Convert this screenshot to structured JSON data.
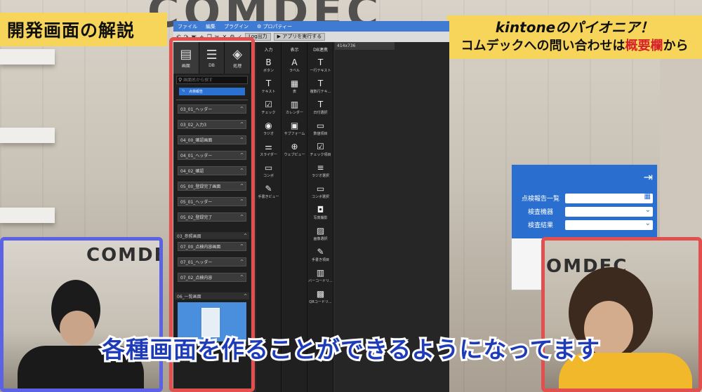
{
  "overlay": {
    "title_left": "開発画面の解説",
    "title_right_line1": "kintoneのパイオニア！",
    "title_right_line2_pre": "コムデックへの問い合わせは",
    "title_right_line2_hl": "概要欄",
    "title_right_line2_post": "から",
    "subtitle_blue1": "各種画面を作ることができる",
    "subtitle_blue2": "ようになってます",
    "bg_logo": "COMDEC",
    "cam_logo_left": "COMDE",
    "cam_logo_right": "OMDEC"
  },
  "app": {
    "menu": [
      "ファイル",
      "編集",
      "プラグイン",
      "⚙ プロパティー"
    ],
    "toolbar": {
      "log_button": "Log出力",
      "run_button": "▶ アプリを実行する"
    },
    "left_tabs": [
      {
        "label": "画面",
        "icon": "screen-icon"
      },
      {
        "label": "DB",
        "icon": "database-icon"
      },
      {
        "label": "処理",
        "icon": "process-icon"
      }
    ],
    "search_placeholder": "画面名から探す",
    "preview_button": "点検報告",
    "screens_group1": [
      "03_01_ヘッダー",
      "03_02_入力3",
      "04_00_確認画面",
      "04_01_ヘッダー",
      "04_02_確認",
      "05_00_登録完了画面",
      "05_01_ヘッダー",
      "05_02_登録完了"
    ],
    "group2_header": "03_参照画面",
    "screens_group2": [
      "07_00_点検内容画面",
      "07_01_ヘッダー",
      "07_02_点検内容"
    ],
    "group3_header": "06_一覧画面",
    "palette": {
      "input_header": "入力",
      "display_header": "表示",
      "db_header": "DB連携",
      "input_items": [
        "ボタン",
        "テキスト",
        "チェック",
        "ラジオ",
        "スライダー",
        "コンボ",
        "手書きビュー"
      ],
      "display_items": [
        "ラベル",
        "表",
        "カレンダー",
        "サブフォーム",
        "ウェブビュー"
      ],
      "db_items": [
        "一行テキスト",
        "複数行テキ...",
        "日付選択",
        "数値項目",
        "チェック項目",
        "ラジオ選択",
        "コンボ選択",
        "写真撮影",
        "画像選択",
        "手書き項目",
        "バーコードリ...",
        "QRコードリ..."
      ]
    },
    "canvas_tab": "414x736"
  },
  "mobile": {
    "rows": [
      {
        "label": "点検報告一覧",
        "icon": "calendar-icon"
      },
      {
        "label": "検査機器",
        "icon": "chevron-down-icon"
      },
      {
        "label": "検査結果",
        "icon": "chevron-down-icon"
      }
    ]
  }
}
